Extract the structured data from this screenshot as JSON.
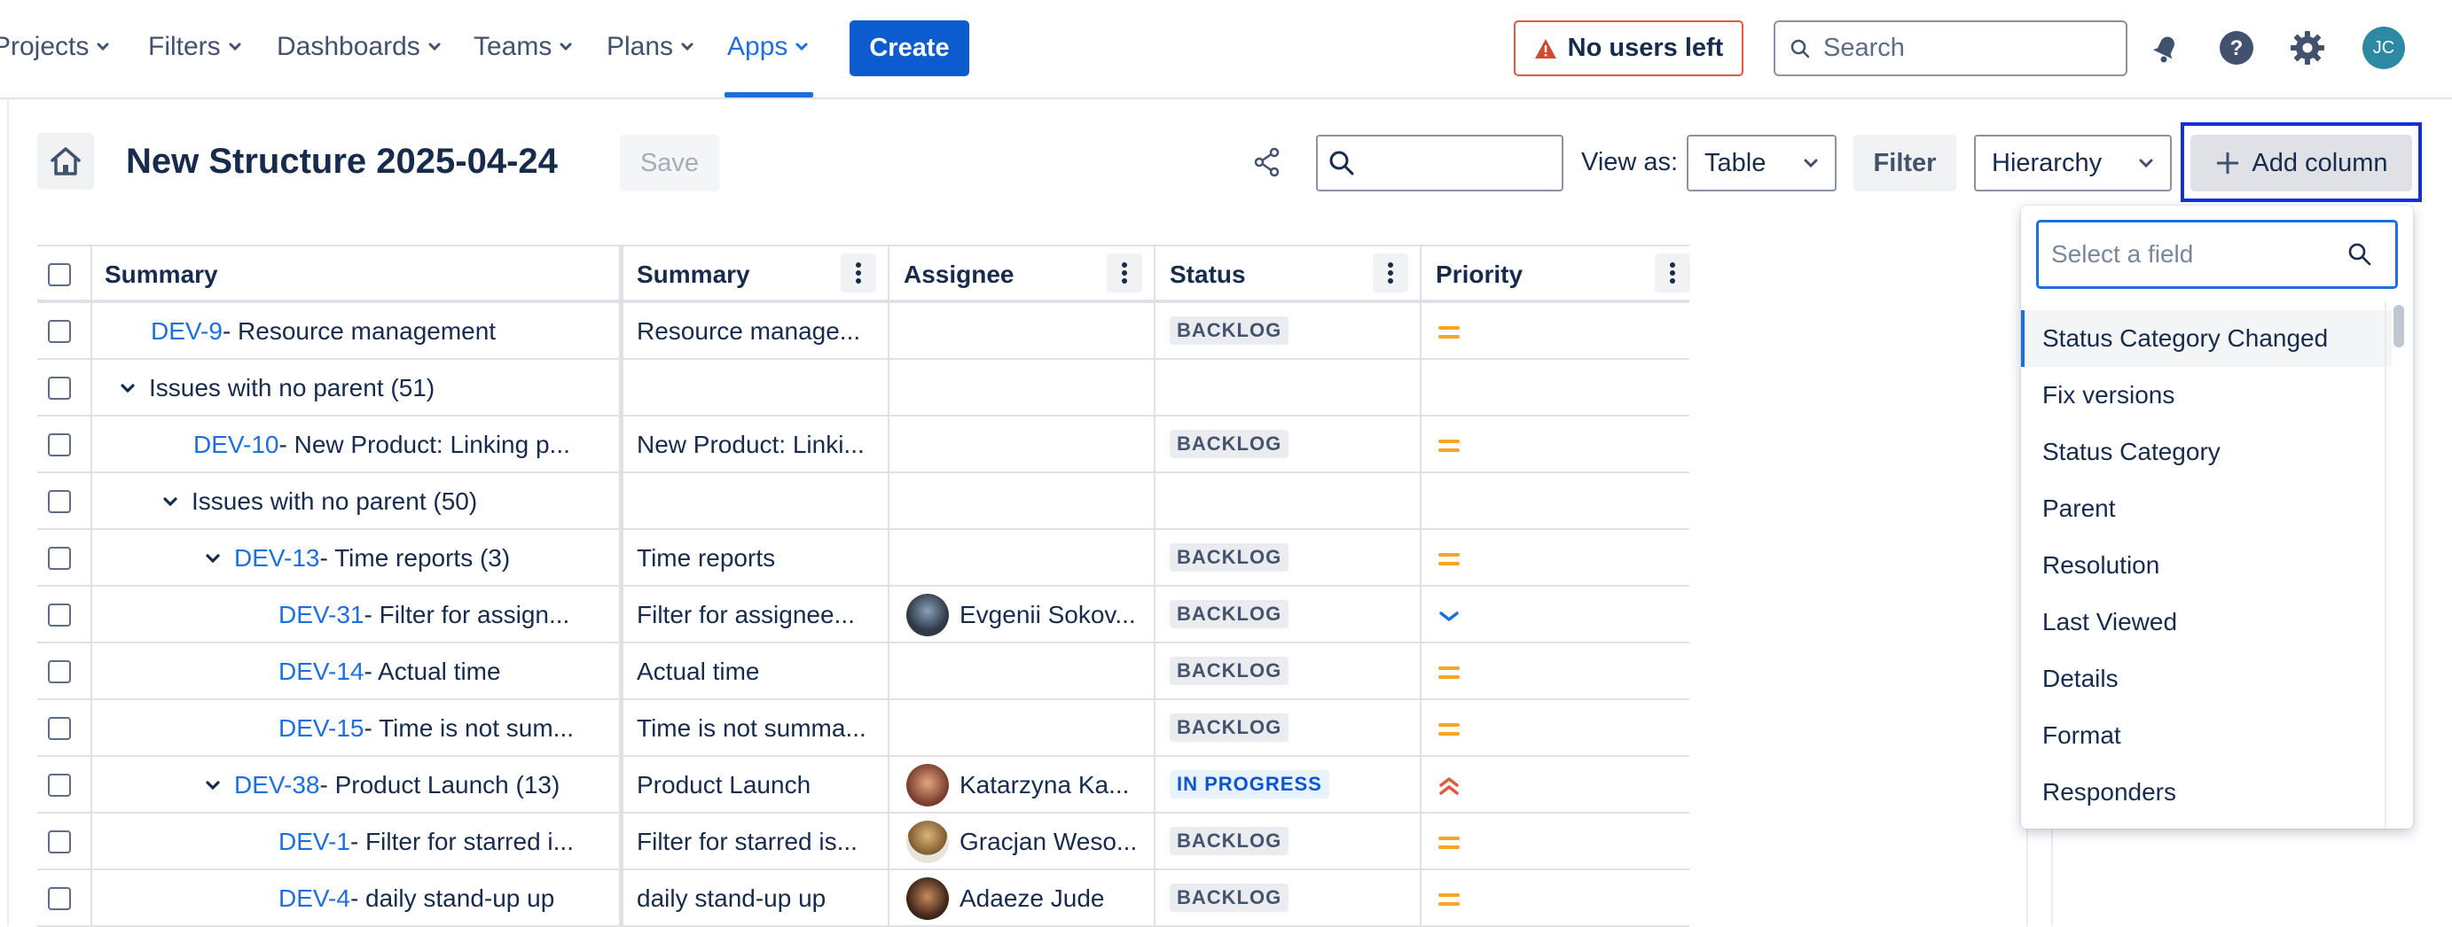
{
  "nav": {
    "items": [
      {
        "label": "Projects",
        "active": false
      },
      {
        "label": "Filters",
        "active": false
      },
      {
        "label": "Dashboards",
        "active": false
      },
      {
        "label": "Teams",
        "active": false
      },
      {
        "label": "Plans",
        "active": false
      },
      {
        "label": "Apps",
        "active": true
      }
    ],
    "create_label": "Create",
    "warning_label": "No users left",
    "search_placeholder": "Search",
    "avatar_initials": "JC",
    "icons": [
      "bell-icon",
      "help-icon",
      "settings-icon"
    ]
  },
  "toolbar": {
    "title": "New Structure 2025-04-24",
    "save_label": "Save",
    "view_as_label": "View as:",
    "view_value": "Table",
    "filter_label": "Filter",
    "hierarchy_value": "Hierarchy",
    "add_column_label": "Add column"
  },
  "table": {
    "headers": [
      "Summary",
      "Summary",
      "Assignee",
      "Status",
      "Priority"
    ],
    "rows": [
      {
        "indent": 0,
        "toggle": false,
        "key": "DEV-9",
        "summary": " - Resource management",
        "summary2": "Resource manage...",
        "assignee": "",
        "status": "BACKLOG",
        "priority": "medium"
      },
      {
        "indent": 0,
        "toggle": true,
        "key": "",
        "summary": "Issues with no parent (51)",
        "summary2": "",
        "assignee": "",
        "status": "",
        "priority": ""
      },
      {
        "indent": 1,
        "toggle": false,
        "key": "DEV-10",
        "summary": " - New Product: Linking p...",
        "summary2": "New Product: Linki...",
        "assignee": "",
        "status": "BACKLOG",
        "priority": "medium"
      },
      {
        "indent": 1,
        "toggle": true,
        "key": "",
        "summary": "Issues with no parent (50)",
        "summary2": "",
        "assignee": "",
        "status": "",
        "priority": ""
      },
      {
        "indent": 2,
        "toggle": true,
        "key": "DEV-13",
        "summary": " - Time reports (3)",
        "summary2": "Time reports",
        "assignee": "",
        "status": "BACKLOG",
        "priority": "medium"
      },
      {
        "indent": 3,
        "toggle": false,
        "key": "DEV-31",
        "summary": " - Filter for assign...",
        "summary2": "Filter for assignee...",
        "assignee": "Evgenii Sokov...",
        "status": "BACKLOG",
        "priority": "low"
      },
      {
        "indent": 3,
        "toggle": false,
        "key": "DEV-14",
        "summary": " - Actual time",
        "summary2": "Actual time",
        "assignee": "",
        "status": "BACKLOG",
        "priority": "medium"
      },
      {
        "indent": 3,
        "toggle": false,
        "key": "DEV-15",
        "summary": " - Time is not sum...",
        "summary2": "Time is not summa...",
        "assignee": "",
        "status": "BACKLOG",
        "priority": "medium"
      },
      {
        "indent": 2,
        "toggle": true,
        "key": "DEV-38",
        "summary": " - Product Launch (13)",
        "summary2": "Product Launch",
        "assignee": "Katarzyna Ka...",
        "status": "IN PROGRESS",
        "priority": "high"
      },
      {
        "indent": 3,
        "toggle": false,
        "key": "DEV-1",
        "summary": " - Filter for starred i...",
        "summary2": "Filter for starred is...",
        "assignee": "Gracjan Weso...",
        "status": "BACKLOG",
        "priority": "medium"
      },
      {
        "indent": 3,
        "toggle": false,
        "key": "DEV-4",
        "summary": " - daily stand-up up",
        "summary2": "daily stand-up up",
        "assignee": "Adaeze Jude",
        "status": "BACKLOG",
        "priority": "medium"
      }
    ]
  },
  "field_picker": {
    "placeholder": "Select a field",
    "items": [
      "Status Category Changed",
      "Fix versions",
      "Status Category",
      "Parent",
      "Resolution",
      "Last Viewed",
      "Details",
      "Format",
      "Responders"
    ],
    "selected_index": 0
  },
  "colors": {
    "accent": "#1d6fe0",
    "warning": "#e25a3e",
    "backlog_bg": "#ebecf0",
    "backlog_fg": "#44546f",
    "inprogress_bg": "#e9f2ff",
    "inprogress_fg": "#0c55cf",
    "priority_medium": "#f5a623",
    "priority_low": "#1d6fe0",
    "priority_high": "#e2583e"
  }
}
